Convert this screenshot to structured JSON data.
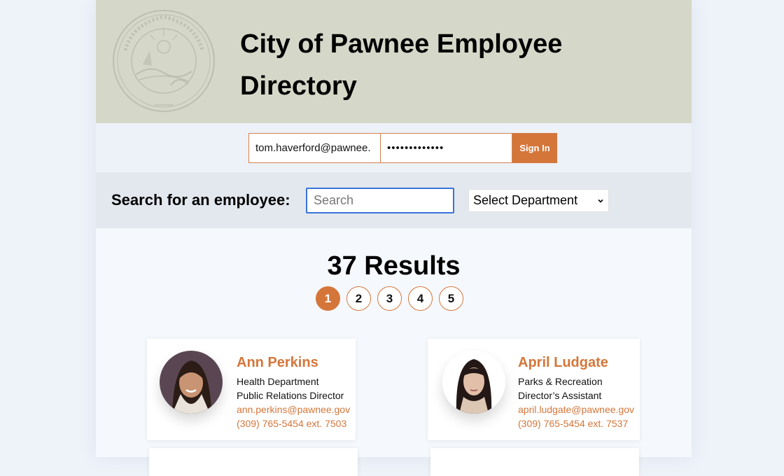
{
  "header": {
    "title": "City of Pawnee Employee Directory",
    "seal_icon": "city-seal"
  },
  "login": {
    "email_value": "tom.haverford@pawnee.",
    "password_value": "•••••••••••••",
    "sign_in_label": "Sign In"
  },
  "search": {
    "label": "Search for an employee:",
    "placeholder": "Search",
    "department_selected": "Select Department"
  },
  "results": {
    "count_label": "37 Results",
    "pages": [
      "1",
      "2",
      "3",
      "4",
      "5"
    ],
    "active_page": "1"
  },
  "employees": [
    {
      "name": "Ann Perkins",
      "department": "Health Department",
      "role": "Public Relations Director",
      "email": "ann.perkins@pawnee.gov",
      "phone": "(309) 765-5454 ext. 7503"
    },
    {
      "name": "April Ludgate",
      "department": "Parks & Recreation",
      "role": "Director’s Assistant",
      "email": "april.ludgate@pawnee.gov",
      "phone": "(309) 765-5454 ext. 7537"
    }
  ],
  "colors": {
    "accent": "#d4763a",
    "header_bg": "#d5d8c8",
    "focus_blue": "#3a73d9"
  }
}
